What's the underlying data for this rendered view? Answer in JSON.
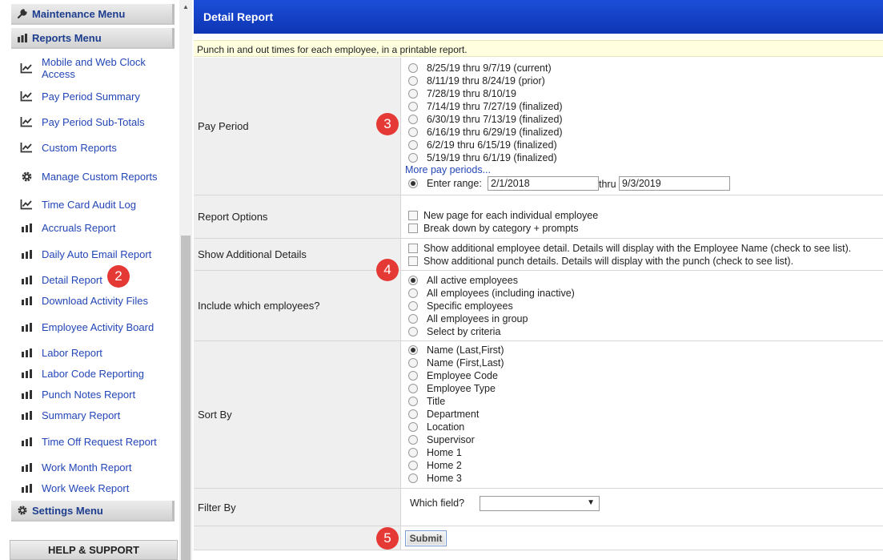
{
  "sidebar": {
    "maintenance_menu": "Maintenance Menu",
    "reports_menu": "Reports Menu",
    "settings_menu": "Settings Menu",
    "help_support": "HELP & SUPPORT",
    "items": [
      {
        "label": "Mobile and Web Clock Access",
        "icon": "line-chart-icon"
      },
      {
        "label": "Pay Period Summary",
        "icon": "line-chart-icon"
      },
      {
        "label": "Pay Period Sub-Totals",
        "icon": "line-chart-icon"
      },
      {
        "label": "Custom Reports",
        "icon": "line-chart-icon"
      },
      {
        "label": "Manage Custom Reports",
        "icon": "gear-icon"
      },
      {
        "label": "Time Card Audit Log",
        "icon": "line-chart-icon"
      },
      {
        "label": "Accruals Report",
        "icon": "bar-chart-icon"
      },
      {
        "label": "Daily Auto Email Report",
        "icon": "bar-chart-icon"
      },
      {
        "label": "Detail Report",
        "icon": "bar-chart-icon"
      },
      {
        "label": "Download Activity Files",
        "icon": "bar-chart-icon"
      },
      {
        "label": "Employee Activity Board",
        "icon": "bar-chart-icon"
      },
      {
        "label": "Labor Report",
        "icon": "bar-chart-icon"
      },
      {
        "label": "Labor Code Reporting",
        "icon": "bar-chart-icon"
      },
      {
        "label": "Punch Notes Report",
        "icon": "bar-chart-icon"
      },
      {
        "label": "Summary Report",
        "icon": "bar-chart-icon"
      },
      {
        "label": "Time Off Request Report",
        "icon": "bar-chart-icon"
      },
      {
        "label": "Work Month Report",
        "icon": "bar-chart-icon"
      },
      {
        "label": "Work Week Report",
        "icon": "bar-chart-icon"
      }
    ]
  },
  "main": {
    "title": "Detail Report",
    "description": "Punch in and out times for each employee, in a printable report.",
    "pay_period": {
      "label": "Pay Period",
      "options": [
        "8/25/19 thru 9/7/19 (current)",
        "8/11/19 thru 8/24/19 (prior)",
        "7/28/19 thru 8/10/19",
        "7/14/19 thru 7/27/19 (finalized)",
        "6/30/19 thru 7/13/19 (finalized)",
        "6/16/19 thru 6/29/19 (finalized)",
        "6/2/19 thru 6/15/19 (finalized)",
        "5/19/19 thru 6/1/19 (finalized)"
      ],
      "more_link": "More pay periods...",
      "range_label": "Enter range:",
      "range_start": "2/1/2018",
      "thru": "thru",
      "range_end": "9/3/2019"
    },
    "report_options": {
      "label": "Report Options",
      "options": [
        "New page for each individual employee",
        "Break down by category + prompts"
      ]
    },
    "additional_details": {
      "label": "Show Additional Details",
      "options": [
        "Show additional employee detail. Details will display with the Employee Name (check to see list).",
        "Show additional punch details. Details will display with the punch (check to see list)."
      ]
    },
    "include_employees": {
      "label": "Include which employees?",
      "options": [
        "All active employees",
        "All employees (including inactive)",
        "Specific employees",
        "All employees in group",
        "Select by criteria"
      ]
    },
    "sort_by": {
      "label": "Sort By",
      "options": [
        "Name (Last,First)",
        "Name (First,Last)",
        "Employee Code",
        "Employee Type",
        "Title",
        "Department",
        "Location",
        "Supervisor",
        "Home 1",
        "Home 2",
        "Home 3"
      ]
    },
    "filter_by": {
      "label": "Filter By",
      "field_label": "Which field?",
      "selected": ""
    },
    "submit": "Submit"
  },
  "badges": [
    "2",
    "3",
    "4",
    "5"
  ],
  "colors": {
    "title_bar": "#1b4ed8",
    "link": "#2346b7",
    "badge": "#e53935",
    "desc_bg": "#ffffe0"
  }
}
